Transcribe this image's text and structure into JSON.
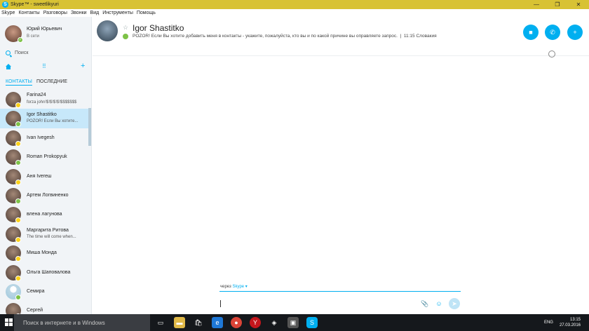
{
  "window": {
    "title": "Skype™ - sweetlikyuri",
    "minimize": "—",
    "maximize": "❐",
    "close": "✕"
  },
  "menu": [
    "Skype",
    "Контакты",
    "Разговоры",
    "Звонки",
    "Вид",
    "Инструменты",
    "Помощь"
  ],
  "profile": {
    "name": "Юрий Юрьевич",
    "status": "В сети"
  },
  "search": {
    "placeholder": "Поиск"
  },
  "tabs": {
    "contacts": "КОНТАКТЫ",
    "recent": "ПОСЛЕДНИЕ"
  },
  "contacts": [
    {
      "name": "Farina24",
      "mood": "forza john!$!$!$!$!$$$$$$$",
      "status": "away"
    },
    {
      "name": "Igor Shastitko",
      "mood": "POZOR! Если Вы хотите...",
      "status": "online",
      "selected": true
    },
    {
      "name": "Ivan Ivegesh",
      "mood": "",
      "status": "away"
    },
    {
      "name": "Roman Prokopyuk",
      "mood": "",
      "status": "online"
    },
    {
      "name": "Аня Ivегеш",
      "mood": "",
      "status": "away"
    },
    {
      "name": "Артем Логвиненко",
      "mood": "",
      "status": "online"
    },
    {
      "name": "влена лагунова",
      "mood": "",
      "status": "away"
    },
    {
      "name": "Маргарита Ритова",
      "mood": "The time will come when...",
      "status": "away"
    },
    {
      "name": "Миша Монда",
      "mood": "",
      "status": "away"
    },
    {
      "name": "Ольга Шаповалова",
      "mood": "",
      "status": "away"
    },
    {
      "name": "Семира",
      "mood": "",
      "status": "online"
    },
    {
      "name": "Сергей",
      "mood": "",
      "status": "online"
    }
  ],
  "chat": {
    "contact_name": "Igor Shastitko",
    "mood": "POZOR! Если Вы хотите добавить меня в контакты - укажите, пожалуйста, кто вы и по какой причине вы оправляете запрос.",
    "local_time": "11:15 Словакия"
  },
  "composer": {
    "via_label": "через",
    "via_link": "Skype ▾"
  },
  "taskbar": {
    "search_placeholder": "Поиск в интернете и в Windows",
    "lang": "ENG",
    "time": "13:15",
    "date": "27.03.2016"
  },
  "colors": {
    "accent": "#00aff0",
    "titlebar": "#d8c234",
    "online": "#7dc247",
    "away": "#fcd116"
  }
}
